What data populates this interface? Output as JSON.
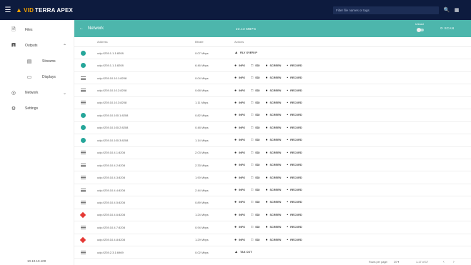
{
  "app": {
    "brand_prefix": "VID",
    "brand_name": "TERRA APEX",
    "search_placeholder": "Filter file names or tags"
  },
  "sidebar": {
    "items": [
      {
        "label": "Files",
        "icon": "file-icon"
      },
      {
        "label": "Outputs",
        "icon": "monitor-icon"
      },
      {
        "label": "Streams",
        "icon": "stream-icon"
      },
      {
        "label": "Displays",
        "icon": "display-icon"
      },
      {
        "label": "Network",
        "icon": "network-icon"
      },
      {
        "label": "Settings",
        "icon": "gear-icon"
      }
    ],
    "footer_ip": "10.10.10.100"
  },
  "network_bar": {
    "title": "Network",
    "rate": "23.13 MBPS",
    "unicast_label": "Unicast",
    "scan_label": "SCAN"
  },
  "table": {
    "headers": {
      "address": "Address",
      "bitrate": "Bitrate",
      "actions": "Actions"
    },
    "rows": [
      {
        "status": "dot",
        "address": "udp://239.1.1.1:8208",
        "bitrate": "0.07 Mbps",
        "type": "play",
        "action_label": "RLV OVER IP"
      },
      {
        "status": "dot",
        "address": "udp://239.1.1.1:8208",
        "bitrate": "6.46 Mbps",
        "type": "full"
      },
      {
        "status": "lines",
        "address": "udp://239.10.10.1:8208",
        "bitrate": "0.04 Mbps",
        "type": "full"
      },
      {
        "status": "lines",
        "address": "udp://239.10.10.2:8208",
        "bitrate": "0.68 Mbps",
        "type": "full"
      },
      {
        "status": "lines",
        "address": "udp://239.10.10.3:8208",
        "bitrate": "1.11 Mbps",
        "type": "full"
      },
      {
        "status": "dot",
        "address": "udp://239.10.100.1:8208",
        "bitrate": "0.82 Mbps",
        "type": "full"
      },
      {
        "status": "dot",
        "address": "udp://239.10.100.2:8208",
        "bitrate": "0.48 Mbps",
        "type": "full"
      },
      {
        "status": "dot",
        "address": "udp://239.10.100.3:8208",
        "bitrate": "1.14 Mbps",
        "type": "full"
      },
      {
        "status": "lines",
        "address": "udp://239.10.4.1:8208",
        "bitrate": "2.03 Mbps",
        "type": "full"
      },
      {
        "status": "lines",
        "address": "udp://239.10.4.2:8208",
        "bitrate": "2.33 Mbps",
        "type": "full"
      },
      {
        "status": "lines",
        "address": "udp://239.10.4.3:8208",
        "bitrate": "1.90 Mbps",
        "type": "full"
      },
      {
        "status": "lines",
        "address": "udp://239.10.4.4:8208",
        "bitrate": "2.44 Mbps",
        "type": "full"
      },
      {
        "status": "lines",
        "address": "udp://239.10.4.5:8208",
        "bitrate": "0.89 Mbps",
        "type": "full"
      },
      {
        "status": "diamond",
        "address": "udp://239.10.4.6:8208",
        "bitrate": "1.24 Mbps",
        "type": "full"
      },
      {
        "status": "lines",
        "address": "udp://239.10.4.7:8208",
        "bitrate": "0.94 Mbps",
        "type": "full"
      },
      {
        "status": "diamond",
        "address": "udp://239.10.4.8:8208",
        "bitrate": "1.29 Mbps",
        "type": "full"
      },
      {
        "status": "lines",
        "address": "udp://239.2.3.1:6969",
        "bitrate": "0.02 Mbps",
        "type": "play",
        "action_label": "TAK COT"
      }
    ],
    "action_labels": {
      "info": "INFO",
      "sdi": "SDI",
      "screen": "SCREEN",
      "record": "RECORD"
    }
  },
  "pagination": {
    "rows_per_page_label": "Rows per page:",
    "rows_per_page_value": "20",
    "range": "1-17 of 17"
  },
  "colors": {
    "topbar": "#0d1b3e",
    "teal": "#4db6ac",
    "status_teal": "#26a69a",
    "status_red": "#e53935",
    "brand_accent": "#f2a100"
  }
}
